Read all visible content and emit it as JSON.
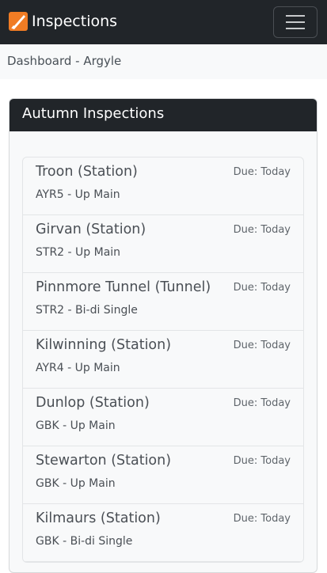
{
  "navbar": {
    "brand_title": "Inspections",
    "logo_icon": "inspections-logo-icon",
    "menu_icon": "hamburger-menu-icon",
    "colors": {
      "bar": "#212529",
      "logo": "#f07c24"
    }
  },
  "breadcrumb": {
    "text": "Dashboard - Argyle"
  },
  "card": {
    "title": "Autumn Inspections",
    "items": [
      {
        "name": "Troon (Station)",
        "location": "AYR5 - Up Main",
        "due": "Due: Today"
      },
      {
        "name": "Girvan (Station)",
        "location": "STR2 - Up Main",
        "due": "Due: Today"
      },
      {
        "name": "Pinnmore Tunnel (Tunnel)",
        "location": "STR2 - Bi-di Single",
        "due": "Due: Today"
      },
      {
        "name": "Kilwinning (Station)",
        "location": "AYR4 - Up Main",
        "due": "Due: Today"
      },
      {
        "name": "Dunlop (Station)",
        "location": "GBK - Up Main",
        "due": "Due: Today"
      },
      {
        "name": "Stewarton (Station)",
        "location": "GBK - Up Main",
        "due": "Due: Today"
      },
      {
        "name": "Kilmaurs (Station)",
        "location": "GBK - Bi-di Single",
        "due": "Due: Today"
      }
    ]
  }
}
